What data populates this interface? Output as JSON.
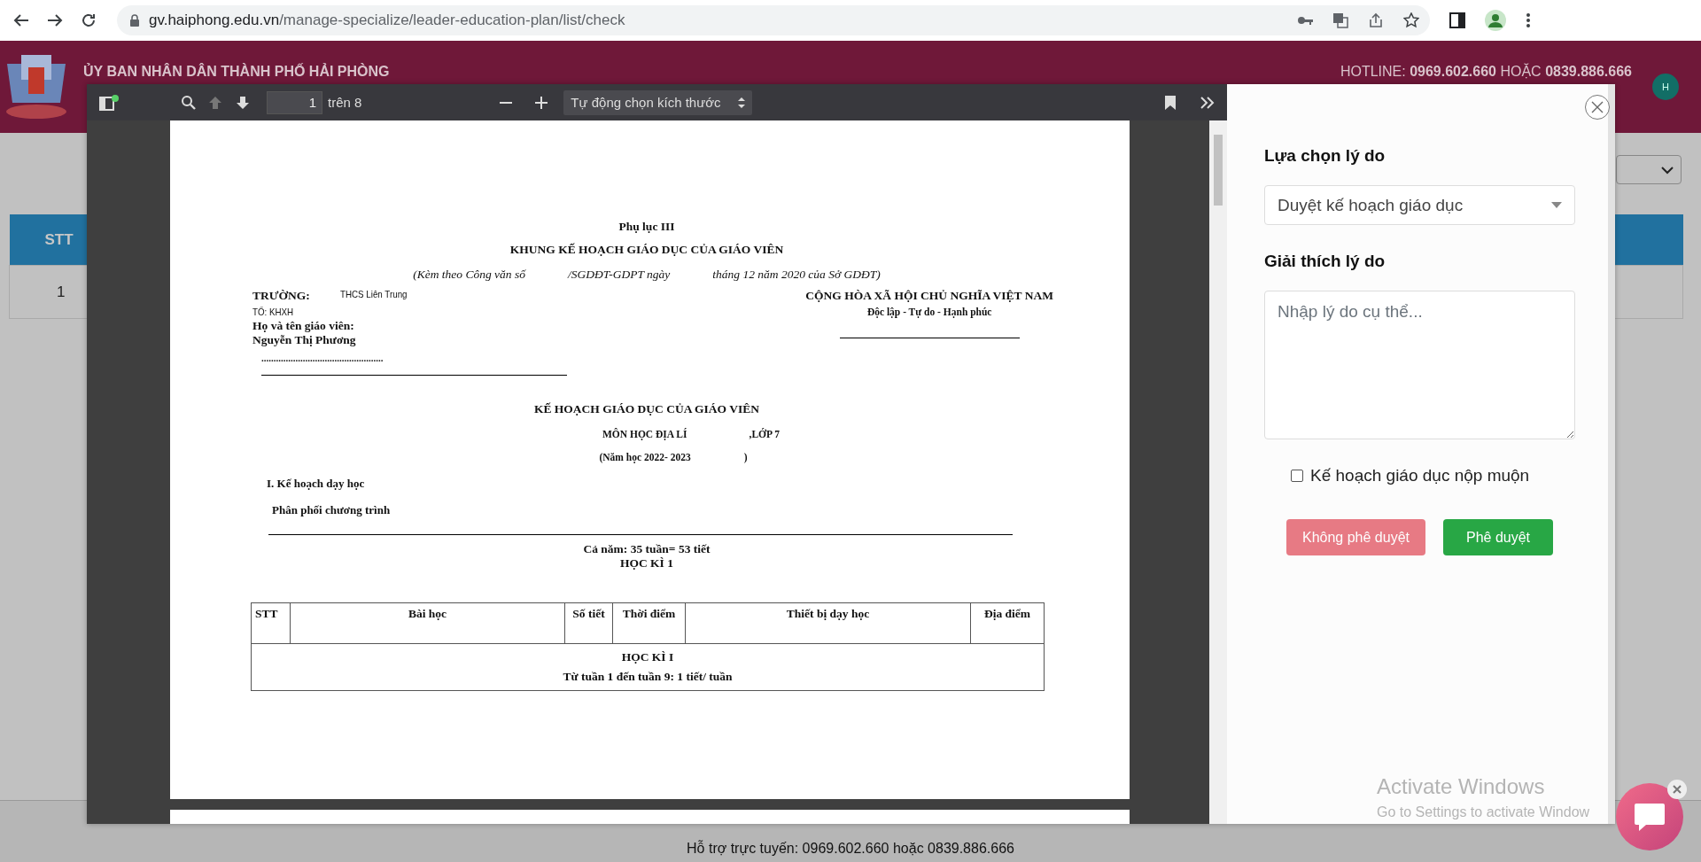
{
  "browser": {
    "url_host": "gv.haiphong.edu.vn",
    "url_path": "/manage-specialize/leader-education-plan/list/check"
  },
  "header": {
    "title": "ỦY BAN NHÂN DÂN THÀNH PHỐ HẢI PHÒNG",
    "hotline": "HOTLINE: **0969.602.660** HOẶC **0839.886.666**",
    "avatar": "H"
  },
  "table": {
    "columns": [
      "STT"
    ],
    "rows": [
      [
        "1"
      ]
    ]
  },
  "footer": {
    "support": "Hỗ trợ trực tuyến: 0969.602.660 hoặc 0839.886.666"
  },
  "pdf_viewer": {
    "page": "1",
    "page_count": "trên 8",
    "zoom": "Tự động chọn kích thước",
    "document": {
      "appendix": "Phụ lục III",
      "title": "KHUNG KẾ HOẠCH GIÁO DỤC CỦA GIÁO VIÊN",
      "reference": [
        "(Kèm theo Công văn số",
        "/SGDĐT-GDPT ngày",
        "tháng 12 năm 2020 của Sở GDĐT)"
      ],
      "school_label": "TRƯỜNG:",
      "school": "THCS Liên Trung",
      "group": "TỔ: KHXH",
      "teacher_label": "Họ và tên giáo viên:",
      "teacher": "Nguyễn Thị Phương",
      "dots": "..................................................",
      "nation": "CỘNG HÒA XÃ HỘI CHỦ NGHĨA VIỆT NAM",
      "motto": "Độc lập - Tự do - Hạnh phúc",
      "plan_title": "KẾ HOẠCH GIÁO DỤC CỦA GIÁO VIÊN",
      "subject": "MÔN HỌC ĐỊA LÍ",
      "grade": ",LỚP 7",
      "year": "(Năm học 2022- 2023",
      "year_close": ")",
      "section": "I. Kế hoạch dạy học",
      "subsection": "Phân phối chương trình",
      "summary": "Cả năm: 35 tuần= 53 tiết",
      "term": "HỌC KÌ 1",
      "table": {
        "columns": [
          "STT",
          "Bài học",
          "Số tiết",
          "Thời điểm",
          "Thiết bị dạy học",
          "Địa điểm"
        ],
        "groups": [
          {
            "title": "HỌC KÌ I",
            "note": "Từ tuần 1 đến tuần 9: 1 tiết/ tuần"
          }
        ]
      }
    }
  },
  "review_panel": {
    "reason_label": "Lựa chọn lý do",
    "reason_value": "Duyệt kế hoạch giáo dục",
    "explain_label": "Giải thích lý do",
    "explain_placeholder": "Nhập lý do cụ thể...",
    "late": {
      "label": "Kế hoạch giáo dục nộp muộn",
      "checked": false
    },
    "buttons": [
      {
        "label": "Không phê duyệt",
        "kind": "reject",
        "disabled": true
      },
      {
        "label": "Phê duyệt",
        "kind": "approve",
        "disabled": false
      }
    ]
  },
  "os_notice": {
    "title": "Activate Windows",
    "text": "Go to Settings to activate Window"
  }
}
